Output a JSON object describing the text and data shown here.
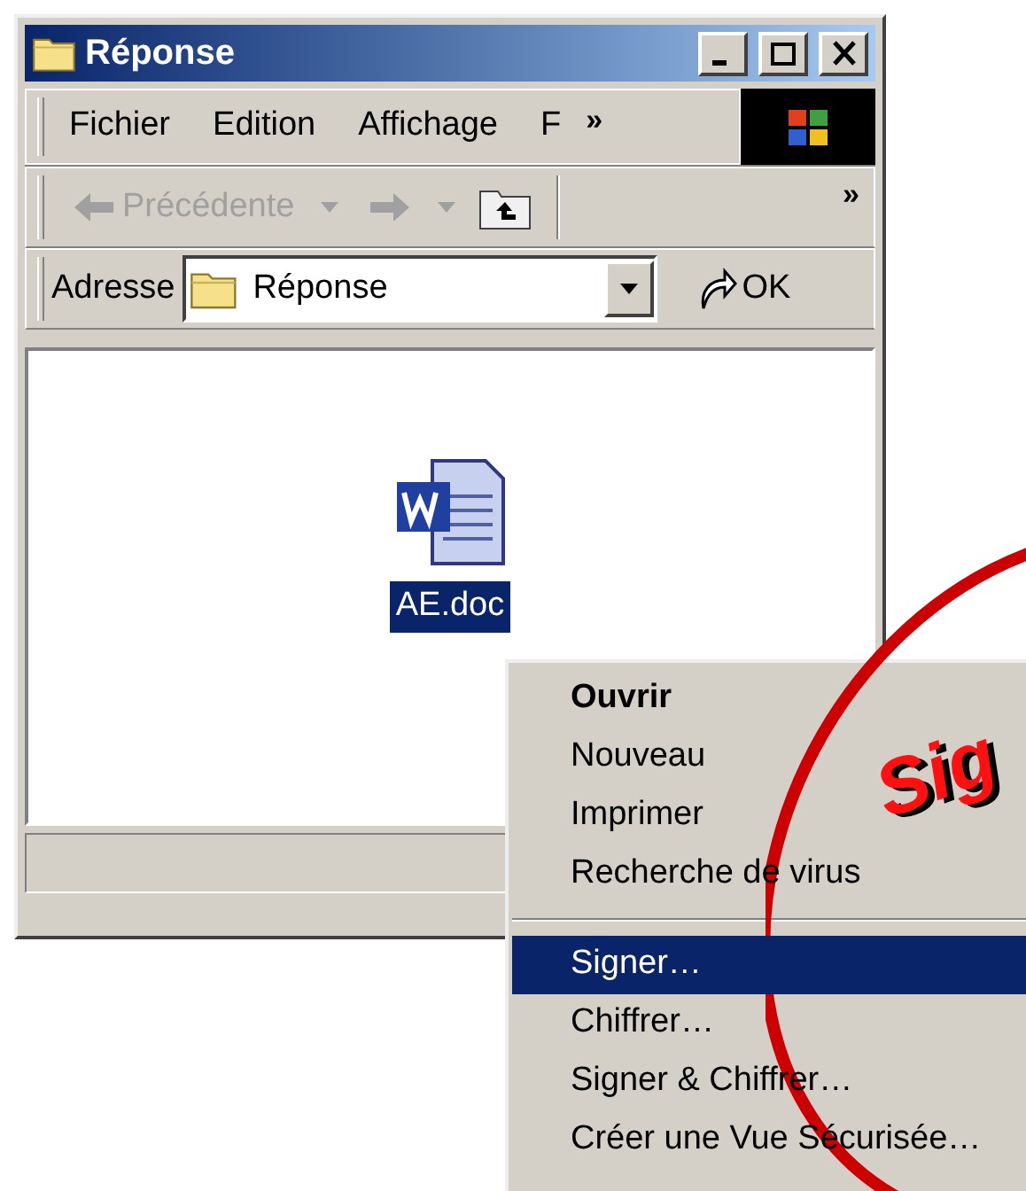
{
  "window": {
    "title": "Réponse"
  },
  "menu_bar": {
    "items": [
      "Fichier",
      "Edition",
      "Affichage",
      "F"
    ],
    "overflow": "»"
  },
  "toolbar": {
    "back": {
      "label": "Précédente",
      "disabled": true
    },
    "forward": {
      "disabled": true
    },
    "overflow": "»"
  },
  "address_bar": {
    "label": "Adresse",
    "value": "Réponse",
    "go": "OK"
  },
  "files": [
    {
      "name": "AE.doc",
      "selected": true
    }
  ],
  "context_menu": [
    {
      "kind": "item",
      "label": "Ouvrir",
      "default": true,
      "selected": false
    },
    {
      "kind": "item",
      "label": "Nouveau",
      "default": false,
      "selected": false
    },
    {
      "kind": "item",
      "label": "Imprimer",
      "default": false,
      "selected": false
    },
    {
      "kind": "item",
      "label": "Recherche de virus",
      "default": false,
      "selected": false
    },
    {
      "kind": "separator"
    },
    {
      "kind": "item",
      "label": "Signer…",
      "default": false,
      "selected": true
    },
    {
      "kind": "item",
      "label": "Chiffrer…",
      "default": false,
      "selected": false
    },
    {
      "kind": "item",
      "label": "Signer & Chiffrer…",
      "default": false,
      "selected": false
    },
    {
      "kind": "item",
      "label": "Créer une Vue Sécurisée…",
      "default": false,
      "selected": false
    }
  ],
  "annotation": {
    "text": "Sig"
  }
}
